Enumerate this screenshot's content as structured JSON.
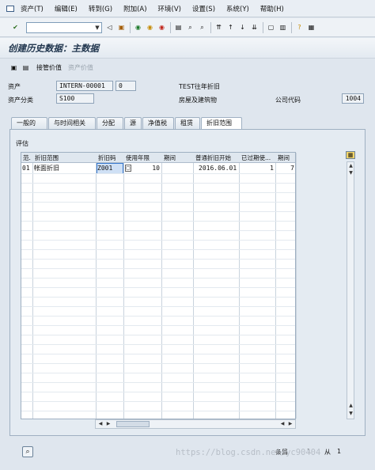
{
  "menubar": {
    "items": [
      "资产(T)",
      "编辑(E)",
      "转到(G)",
      "附加(A)",
      "环境(V)",
      "设置(S)",
      "系统(Y)",
      "帮助(H)"
    ]
  },
  "toolbar": {
    "command_value": ""
  },
  "title": "创建历史数据：主数据",
  "app_toolbar": {
    "takeover_label": "接管价值",
    "asset_value_label": "资产价值"
  },
  "header": {
    "asset_label": "资产",
    "asset_number": "INTERN-00001",
    "asset_subnumber": "0",
    "asset_description": "TEST往年折旧",
    "asset_class_label": "资产分类",
    "asset_class": "S100",
    "asset_class_description": "房屋及建筑物",
    "company_code_label": "公司代码",
    "company_code": "1004"
  },
  "tabs": [
    "一般的",
    "与时间相关",
    "分配",
    "源",
    "净值税",
    "租赁",
    "折旧范围"
  ],
  "group_title": "评估",
  "table": {
    "headers": [
      "范.",
      "折旧范围",
      "折旧码",
      "使用年限",
      "期间",
      "普通折旧开始",
      "已过期使...",
      "期间"
    ],
    "rows": [
      [
        "01",
        "帐面折旧",
        "Z001",
        "10",
        "",
        "2016.06.01",
        "1",
        "7"
      ]
    ]
  },
  "footer": {
    "entry_label": "条目",
    "entry_value": "1",
    "of_label": "从",
    "of_value": "1"
  },
  "watermark": "https://blog.csdn.net/yc90404"
}
